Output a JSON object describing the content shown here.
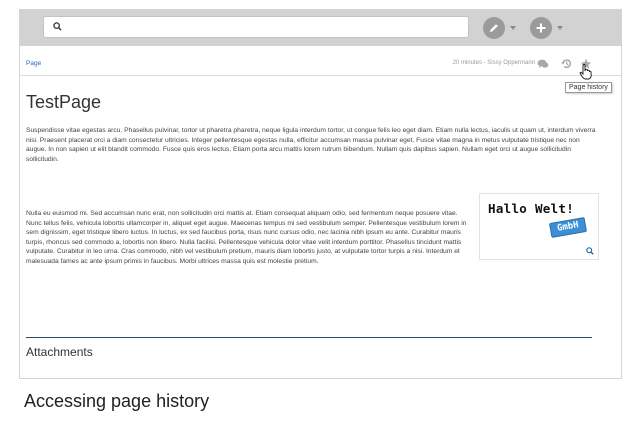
{
  "search": {
    "placeholder": ""
  },
  "page": {
    "breadcrumb": "Page",
    "last_edit": "20 minutes - Sissy Oppermann",
    "history_tooltip": "Page history",
    "title": "TestPage",
    "paragraph1": "Suspendisse vitae egestas arcu. Phasellus pulvinar, tortor ut pharetra pharetra, neque ligula interdum tortor, ut congue felis leo eget diam. Etiam nulla lectus, iaculis ut quam ut, interdum viverra nisi. Praesent placerat orci a diam consectetur ultricies. Integer pellentesque egestas nulla, efficitur accumsan massa pulvinar eget. Fusce vitae magna in metus vulputate tristique nec non augue. In non sapien ut elit blandit commodo. Fusce quis eros lectus. Etiam porta arcu mattis lorem rutrum bibendum. Nullam quis dapibus sapien. Nullam eget orci ut augue sollicitudin sollicitudin.",
    "paragraph2": "Nulla eu euismod mi. Sed accumsan nunc erat, non sollicitudin orci mattis at. Etiam consequat aliquam odio, sed fermentum neque posuere vitae. Nunc tellus felis, vehicula lobortis ullamcorper in, aliquet eget augue. Maecenas tempus mi sed vestibulum semper. Pellentesque vestibulum lorem in sem dignissim, eget tristique libero luctus. In luctus, ex sed faucibus porta, risus nunc cursus odio, nec lacinia nibh ipsum eu ante. Curabitur mauris turpis, rhoncus sed commodo a, lobortis non libero. Nulla facilisi. Pellentesque vehicula dolor vitae velit interdum porttitor. Phasellus tincidunt mattis vulputate. Curabitur in leo urna. Cras commodo, nibh vel vestibulum pretium, mauris diam lobortis justo, at vulputate tortor turpis a nisi. Interdum et malesuada fames ac ante ipsum primis in faucibus. Morbi ultrices massa quis est molestie pretium.",
    "image_text_main": "Hallo Welt!",
    "image_text_badge": "GmbH",
    "attachments_heading": "Attachments"
  },
  "caption": "Accessing page history",
  "colors": {
    "toolbar_bg": "#d2d2d2",
    "icon_gray": "#9b9b9b",
    "link_blue": "#2a67b3",
    "badge_blue": "#3b8fd4"
  },
  "icons": {
    "search": "search-icon",
    "edit": "pencil-icon",
    "add": "plus-icon",
    "discussion": "chat-bubbles-icon",
    "history": "history-icon",
    "watch": "star-icon",
    "zoom": "zoom-icon",
    "cursor": "hand-cursor-icon"
  }
}
